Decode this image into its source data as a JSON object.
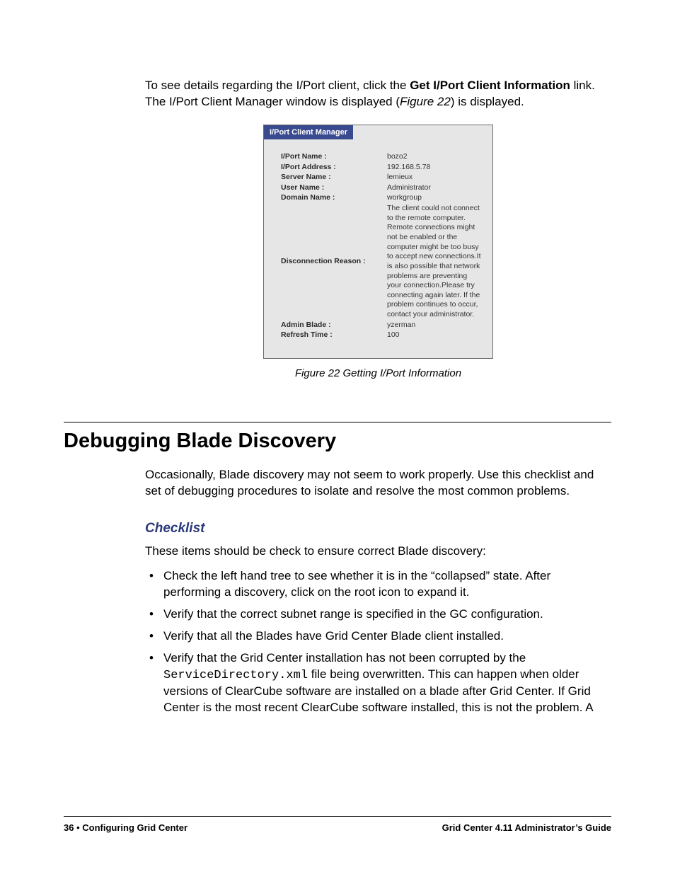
{
  "intro": {
    "pre": "To see details regarding the I/Port client, click the ",
    "link": "Get I/Port Client Information",
    "post1": " link. The I/Port Client Manager window is displayed (",
    "figref": "Figure 22",
    "post2": ") is displayed."
  },
  "figure": {
    "title": "I/Port Client Manager",
    "caption": "Figure 22  Getting I/Port Information",
    "rows": [
      {
        "label": "I/Port Name :",
        "value": "bozo2"
      },
      {
        "label": "I/Port Address :",
        "value": "192.168.5.78"
      },
      {
        "label": "Server Name :",
        "value": "lemieux"
      },
      {
        "label": "User Name :",
        "value": "Administrator"
      },
      {
        "label": "Domain Name :",
        "value": "workgroup"
      },
      {
        "label": "Disconnection Reason :",
        "value": "The client could not connect to the remote computer. Remote connections might not be enabled or the computer might be too busy to accept new connections.It is also possible that network problems are preventing your connection.Please try connecting again later. If the problem continues to occur, contact your administrator.",
        "discon": true
      },
      {
        "label": "Admin Blade :",
        "value": "yzerman"
      },
      {
        "label": "Refresh Time :",
        "value": "100"
      }
    ]
  },
  "section": {
    "heading": "Debugging Blade Discovery",
    "para": "Occasionally, Blade discovery may not seem to work properly. Use this checklist and set of debugging procedures to isolate and resolve the most common problems."
  },
  "checklist": {
    "heading": "Checklist",
    "intro": "These items should be check to ensure correct Blade discovery:",
    "items": [
      {
        "text": "Check the left hand tree to see whether it is in the “collapsed” state. After performing a discovery, click on the root icon to expand it."
      },
      {
        "text": "Verify that the correct subnet range is specified in the GC configuration."
      },
      {
        "text": "Verify that all the Blades have Grid Center Blade client installed."
      },
      {
        "pre": "Verify that the Grid Center installation has not been corrupted by the ",
        "code": "ServiceDirectory.xml",
        "post": " file being overwritten. This can happen when older versions of ClearCube software are installed on a blade after Grid Center. If Grid Center is the most recent ClearCube software installed, this is not the problem. A"
      }
    ]
  },
  "footer": {
    "left_page": "36",
    "left_sep": " • ",
    "left_title": "Configuring Grid Center",
    "right": "Grid Center 4.11 Administrator’s Guide"
  }
}
